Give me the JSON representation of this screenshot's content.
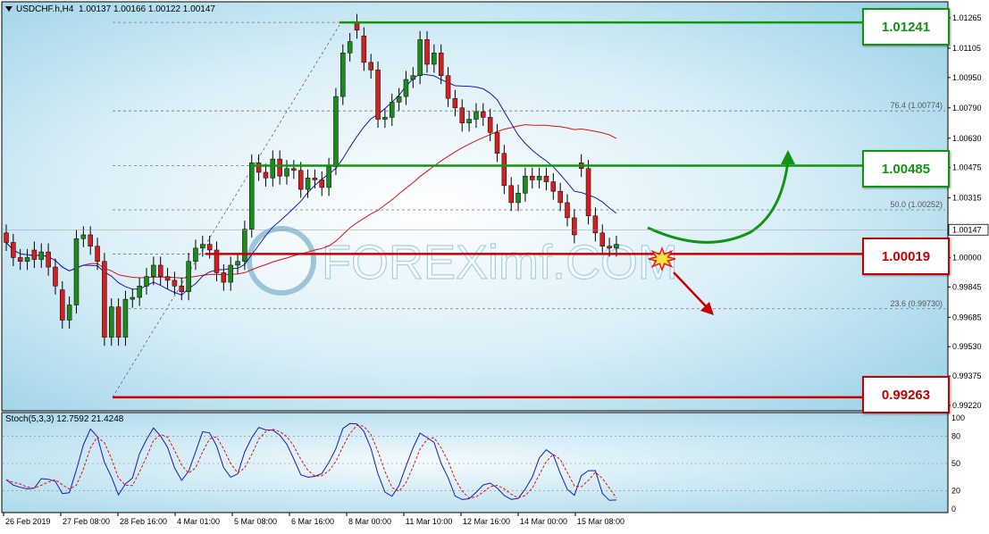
{
  "header": {
    "symbol": "USDCHF.h,H4",
    "ohlc": "1.00137 1.00166 1.00122 1.00147"
  },
  "stoch_header": "Stoch(5,3,3) 12.7592 21.4248",
  "watermark": "FOREXimf.COM",
  "colors": {
    "bg_blue": "#bfe4f1",
    "bull": "#1e8a1e",
    "bear": "#d21f1f",
    "green_level": "#149214",
    "red_level": "#c80000",
    "ma_fast": "#1a1ab4",
    "ma_slow": "#e01010"
  },
  "levels": [
    {
      "label": "1.01241",
      "price": 1.01241,
      "color": "green"
    },
    {
      "label": "1.00485",
      "price": 1.00485,
      "color": "green"
    },
    {
      "label": "1.00019",
      "price": 1.00019,
      "color": "red"
    },
    {
      "label": "0.99263",
      "price": 0.99263,
      "color": "red"
    }
  ],
  "fib_labels": [
    {
      "text": "76.4 (1.00774)",
      "price": 1.00774
    },
    {
      "text": "50.0 (1.00252)",
      "price": 1.00252
    },
    {
      "text": "23.6 (0.99730)",
      "price": 0.9973
    }
  ],
  "chart_data": {
    "type": "candlestick",
    "price_axis_ticks": [
      "1.01265",
      "1.01105",
      "1.00950",
      "1.00790",
      "1.00630",
      "1.00475",
      "1.00315",
      "1.00147",
      "1.00000",
      "0.99845",
      "0.99685",
      "0.99530",
      "0.99375",
      "0.99220"
    ],
    "price_axis_values": [
      1.01265,
      1.01105,
      1.0095,
      1.0079,
      1.0063,
      1.00475,
      1.00315,
      1.00147,
      1.0,
      0.99845,
      0.99685,
      0.9953,
      0.99375,
      0.9922
    ],
    "current_price": "1.00147",
    "ylim": [
      0.9918,
      1.0131
    ],
    "time_labels": [
      "26 Feb 2019",
      "27 Feb 08:00",
      "28 Feb 16:00",
      "4 Mar 01:00",
      "5 Mar 08:00",
      "6 Mar 16:00",
      "8 Mar 00:00",
      "11 Mar 10:00",
      "12 Mar 16:00",
      "14 Mar 00:00",
      "15 Mar 08:00"
    ],
    "candles_close": [
      1.0008,
      1.0,
      0.9998,
      1.0,
      0.9999,
      1.0003,
      0.9995,
      0.9985,
      0.9967,
      0.9975,
      1.001,
      1.0012,
      1.0006,
      0.9998,
      0.9958,
      0.9974,
      0.9958,
      0.9978,
      0.9979,
      0.9985,
      0.999,
      0.9996,
      0.999,
      0.9988,
      0.9985,
      0.9982,
      0.9998,
      1.0005,
      1.0007,
      1.0004,
      0.9992,
      0.9987,
      0.9996,
      0.9998,
      1.0015,
      1.005,
      1.0045,
      1.0042,
      1.0052,
      1.0043,
      1.0047,
      1.0046,
      1.0036,
      1.0042,
      1.0041,
      1.0037,
      1.0048,
      1.0085,
      1.0108,
      1.0114,
      1.012,
      1.0103,
      1.0099,
      1.0073,
      1.0074,
      1.0082,
      1.0085,
      1.0094,
      1.0096,
      1.0115,
      1.0102,
      1.0108,
      1.0096,
      1.0084,
      1.0079,
      1.0071,
      1.0073,
      1.0077,
      1.0074,
      1.0066,
      1.0055,
      1.0038,
      1.0029,
      1.0034,
      1.0043,
      1.0041,
      1.0043,
      1.004,
      1.0035,
      1.0029,
      1.0021,
      1.0012,
      1.0047,
      1.0022,
      1.0013,
      1.0006,
      1.0005,
      1.0007
    ],
    "candles_open": [
      1.0013,
      1.0008,
      1.0,
      0.9998,
      1.0004,
      0.9999,
      1.0003,
      0.9995,
      0.9983,
      0.9967,
      0.9975,
      1.001,
      1.0012,
      1.0006,
      0.9998,
      0.9958,
      0.9974,
      0.9958,
      0.9978,
      0.9979,
      0.9985,
      0.999,
      0.9996,
      0.999,
      0.9988,
      0.9985,
      0.9982,
      0.9998,
      1.0005,
      1.0007,
      1.0004,
      0.9992,
      0.9987,
      0.9996,
      0.9998,
      1.0015,
      1.005,
      1.0045,
      1.0042,
      1.0052,
      1.0043,
      1.0047,
      1.0046,
      1.0036,
      1.0042,
      1.0041,
      1.0037,
      1.0048,
      1.0085,
      1.0108,
      1.0124,
      1.0117,
      1.0103,
      1.0099,
      1.0073,
      1.0074,
      1.0082,
      1.0085,
      1.0094,
      1.0096,
      1.0115,
      1.0102,
      1.0108,
      1.0096,
      1.0084,
      1.0079,
      1.0071,
      1.0073,
      1.0077,
      1.0074,
      1.0066,
      1.0055,
      1.0038,
      1.0029,
      1.0034,
      1.0043,
      1.0041,
      1.0043,
      1.004,
      1.0035,
      1.0029,
      1.0021,
      1.005,
      1.0047,
      1.0022,
      1.0013,
      1.0006,
      1.0005
    ]
  }
}
